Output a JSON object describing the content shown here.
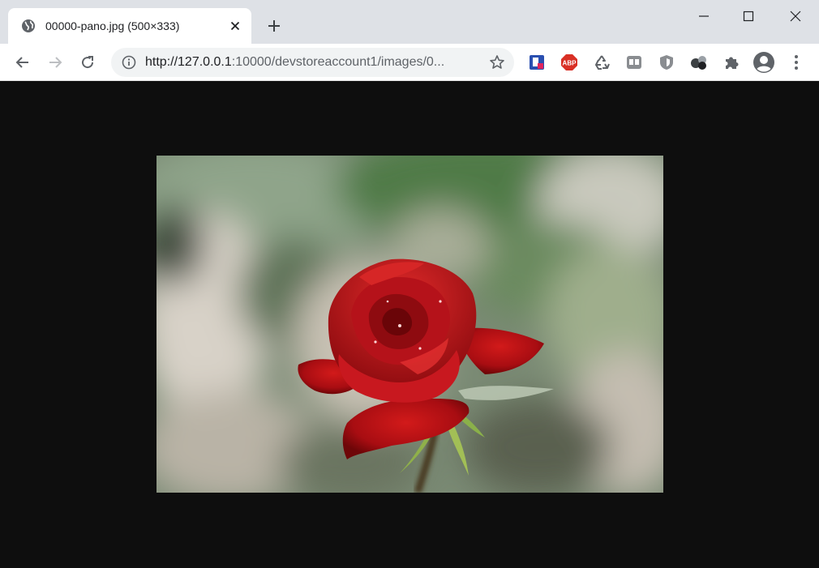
{
  "tab": {
    "title": "00000-pano.jpg (500×333)",
    "favicon": "globe-icon"
  },
  "window_controls": [
    "minimize-icon",
    "maximize-icon",
    "close-icon"
  ],
  "toolbar": {
    "url_host": "http://127.0.0.1",
    "url_rest": ":10000/devstoreaccount1/images/0...",
    "extensions": [
      "bookmark-extension-icon",
      "adblock-icon",
      "recycle-icon",
      "tiles-extension-icon",
      "shield-icon",
      "circles-extension-icon",
      "puzzle-icon",
      "profile-icon",
      "more-menu-icon"
    ],
    "adblock_label": "ABP"
  },
  "content": {
    "background": "#0e0e0e",
    "image": "red-rose-photo"
  }
}
